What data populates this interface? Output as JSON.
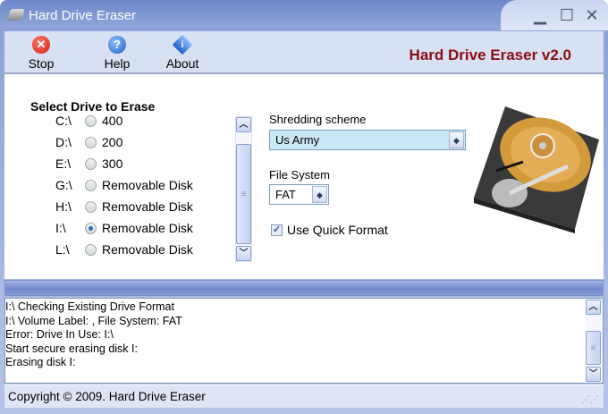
{
  "window": {
    "title": "Hard Drive Eraser"
  },
  "toolbar": {
    "stop": "Stop",
    "help": "Help",
    "about": "About",
    "brand": "Hard Drive Eraser v2.0"
  },
  "drives": {
    "title": "Select Drive to Erase",
    "items": [
      {
        "letter": "C:\\",
        "label": "400",
        "selected": false
      },
      {
        "letter": "D:\\",
        "label": "200",
        "selected": false
      },
      {
        "letter": "E:\\",
        "label": "300",
        "selected": false
      },
      {
        "letter": "G:\\",
        "label": "Removable Disk",
        "selected": false
      },
      {
        "letter": "H:\\",
        "label": "Removable Disk",
        "selected": false
      },
      {
        "letter": "I:\\",
        "label": "Removable Disk",
        "selected": true
      },
      {
        "letter": "L:\\",
        "label": "Removable Disk",
        "selected": false
      }
    ]
  },
  "options": {
    "shredding_label": "Shredding scheme",
    "shredding_value": "Us Army",
    "fs_label": "File System",
    "fs_value": "FAT",
    "quick_format_label": "Use Quick Format",
    "quick_format_checked": true
  },
  "log": [
    "I:\\ Checking Existing Drive Format",
    "I:\\ Volume Label: , File System: FAT",
    "Error: Drive In Use: I:\\",
    "Start secure erasing disk I:",
    "Erasing disk I:"
  ],
  "status": {
    "text": "Copyright © 2009. Hard Drive Eraser"
  },
  "colors": {
    "brand": "#8b0e14",
    "accent": "#6f86c9"
  }
}
